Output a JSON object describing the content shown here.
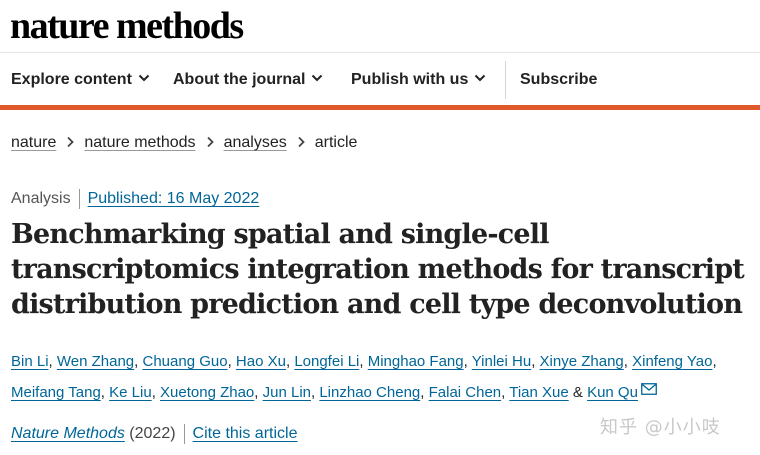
{
  "masthead": {
    "logo": "nature methods"
  },
  "nav": {
    "items": [
      {
        "label": "Explore content"
      },
      {
        "label": "About the journal"
      },
      {
        "label": "Publish with us"
      },
      {
        "label": "Subscribe"
      }
    ]
  },
  "breadcrumb": [
    "nature",
    "nature methods",
    "analyses",
    "article"
  ],
  "article": {
    "type": "Analysis",
    "published": "Published: 16 May 2022",
    "title": "Benchmarking spatial and single-cell transcriptomics integration methods for transcript distribution prediction and cell type deconvolution",
    "authors": [
      "Bin Li",
      "Wen Zhang",
      "Chuang Guo",
      "Hao Xu",
      "Longfei Li",
      "Minghao Fang",
      "Yinlei Hu",
      "Xinye Zhang",
      "Xinfeng Yao",
      "Meifang Tang",
      "Ke Liu",
      "Xuetong Zhao",
      "Jun Lin",
      "Linzhao Cheng",
      "Falai Chen",
      "Tian Xue",
      "Kun Qu"
    ],
    "author_sep": ", ",
    "author_and": " & ",
    "citation": {
      "journal": "Nature Methods",
      "year": "(2022)",
      "cite_label": "Cite this article"
    }
  },
  "icons": {
    "nav_chevron": "chevron-down-icon",
    "breadcrumb_sep": "chevron-right-icon",
    "email": "envelope-icon"
  },
  "colors": {
    "accent_bar": "#e0592a",
    "link": "#006699"
  },
  "watermark": "知乎 @小小吱"
}
